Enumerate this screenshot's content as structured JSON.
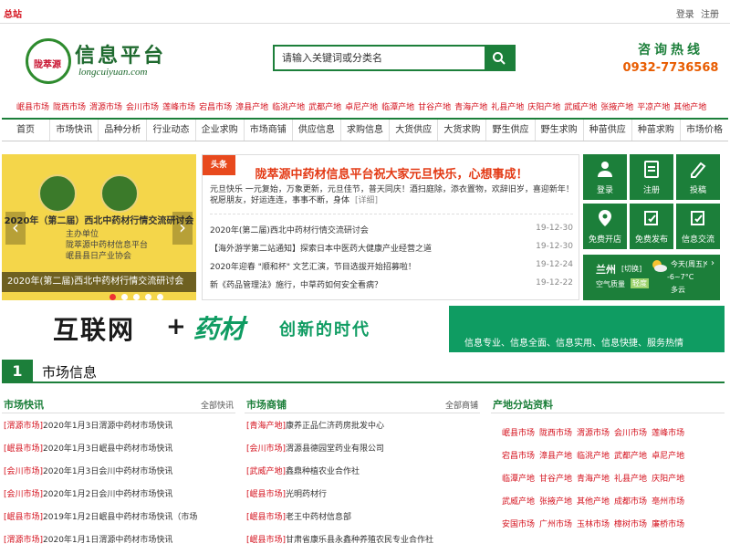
{
  "topbar": {
    "home": "总站",
    "login": "登录",
    "register": "注册"
  },
  "logo": {
    "seal_text": "陇萃源",
    "name": "信息平台",
    "domain": "longcuiyuan.com"
  },
  "search": {
    "placeholder": "请输入关键词或分类名"
  },
  "hotline": {
    "title": "咨询热线",
    "number": "0932-7736568"
  },
  "regions": [
    "岷县市场",
    "陇西市场",
    "渭源市场",
    "会川市场",
    "莲峰市场",
    "宕昌市场",
    "漳县产地",
    "临洮产地",
    "武都产地",
    "卓尼产地",
    "临潭产地",
    "甘谷产地",
    "青海产地",
    "礼县产地",
    "庆阳产地",
    "武威产地",
    "张掖产地",
    "平凉产地",
    "其他产地"
  ],
  "nav": [
    "首页",
    "市场快讯",
    "品种分析",
    "行业动态",
    "企业求购",
    "市场商铺",
    "供应信息",
    "求购信息",
    "大货供应",
    "大货求购",
    "野生供应",
    "野生求购",
    "种苗供应",
    "种苗求购",
    "市场价格"
  ],
  "slider": {
    "headline": "2020年（第二届）西北中药材行情交流研讨会",
    "sub": [
      "主办单位",
      "陇萃源中药材信息平台",
      "岷县县日产业协会"
    ],
    "caption": "2020年(第二届)西北中药材行情交流研讨会",
    "prev": "‹",
    "next": "›"
  },
  "news": {
    "tag": "头条",
    "headline": "陇萃源中药材信息平台祝大家元旦快乐，心想事成！",
    "desc": "元旦快乐 一元复始，万象更新，元旦佳节，普天同庆！酒扫庭除，添衣置物，欢辞旧岁，喜迎新年！祝愿朋友，好运连连，事事不断，身体",
    "more": "[详细]",
    "items": [
      {
        "title": "2020年(第二届)西北中药材行情交流研讨会",
        "date": "19-12-30"
      },
      {
        "title": "【海外游学第二站通知】探索日本中医药大健康产业经营之道",
        "date": "19-12-30"
      },
      {
        "title": "2020年迎春 \"顺和杯\" 文艺汇演，节目选拔开始招募啦！",
        "date": "19-12-24"
      },
      {
        "title": "新《药品管理法》施行，中草药如何安全看病？",
        "date": "19-12-22"
      }
    ]
  },
  "tiles": [
    "登录",
    "注册",
    "投稿",
    "免费开店",
    "免费发布",
    "信息交流"
  ],
  "weather": {
    "city": "兰州",
    "switch": "[切换]",
    "aq_label": "空气质量",
    "aq_value": "轻度",
    "day": "今天(周五)",
    "temp": "-6~7°C",
    "cond": "多云",
    "nav": "‹ ›"
  },
  "banner": {
    "w1": "互联网",
    "plus": "+",
    "w2": "药材",
    "w3": "创新的时代",
    "slogan": "信息专业、信息全面、信息实用、信息快捷、服务热情"
  },
  "section": {
    "num": "1",
    "title": "市场信息"
  },
  "col1": {
    "title": "市场快讯",
    "all": "全部快讯",
    "items": [
      {
        "tag": "[渭源市场]",
        "text": "2020年1月3日渭源中药材市场快讯"
      },
      {
        "tag": "[岷县市场]",
        "text": "2020年1月3日岷县中药材市场快讯"
      },
      {
        "tag": "[会川市场]",
        "text": "2020年1月3日会川中药材市场快讯"
      },
      {
        "tag": "[会川市场]",
        "text": "2020年1月2日会川中药材市场快讯"
      },
      {
        "tag": "[岷县市场]",
        "text": "2019年1月2日岷县中药材市场快讯（市场"
      },
      {
        "tag": "[渭源市场]",
        "text": "2020年1月1日渭源中药材市场快讯"
      }
    ]
  },
  "col2": {
    "title": "市场商铺",
    "all": "全部商铺",
    "items": [
      {
        "tag": "[青海产地]",
        "text": "康养正品仁济药房批发中心"
      },
      {
        "tag": "[会川市场]",
        "text": "渭源县德园堂药业有限公司"
      },
      {
        "tag": "[武威产地]",
        "text": "鑫鼎种植农业合作社"
      },
      {
        "tag": "[岷县市场]",
        "text": "光明药材行"
      },
      {
        "tag": "[岷县市场]",
        "text": "老王中药材信息部"
      },
      {
        "tag": "[岷县市场]",
        "text": "甘肃省康乐县永鑫种养殖农民专业合作社"
      }
    ]
  },
  "col3": {
    "title": "产地分站资料",
    "rows": [
      [
        "岷县市场",
        "陇西市场",
        "渭源市场",
        "会川市场",
        "莲峰市场"
      ],
      [
        "宕昌市场",
        "漳县产地",
        "临洮产地",
        "武都产地",
        "卓尼产地"
      ],
      [
        "临潭产地",
        "甘谷产地",
        "青海产地",
        "礼县产地",
        "庆阳产地"
      ],
      [
        "武威产地",
        "张掖产地",
        "其他产地",
        "成都市场",
        "亳州市场"
      ],
      [
        "安国市场",
        "广州市场",
        "玉林市场",
        "樟树市场",
        "廉桥市场"
      ]
    ]
  },
  "colors": {
    "green": "#1c7f3a",
    "red": "#d4101c",
    "orange": "#e85c00"
  }
}
